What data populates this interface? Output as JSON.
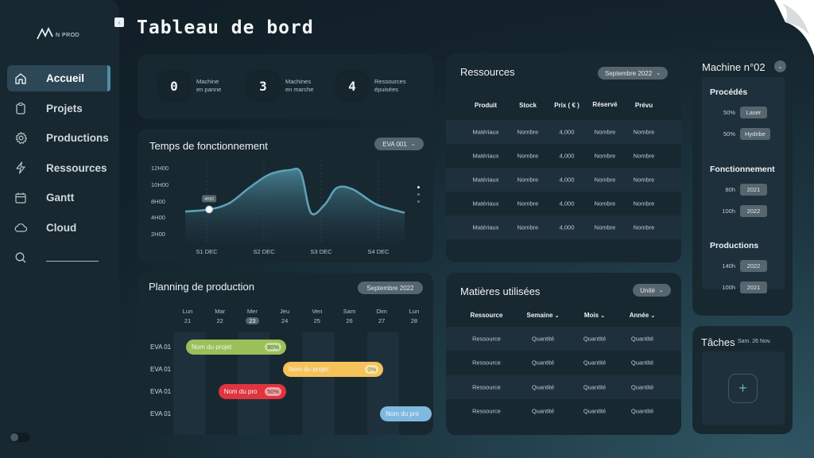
{
  "app": {
    "logo_text": "N PROD",
    "collapse_icon": "chevron-left-icon",
    "page_title": "Tableau de bord"
  },
  "sidebar": {
    "items": [
      {
        "label": "Accueil",
        "icon": "home-icon",
        "active": true
      },
      {
        "label": "Projets",
        "icon": "clipboard-icon",
        "active": false
      },
      {
        "label": "Productions",
        "icon": "gear-icon",
        "active": false
      },
      {
        "label": "Ressources",
        "icon": "lightning-icon",
        "active": false
      },
      {
        "label": "Gantt",
        "icon": "calendar-icon",
        "active": false
      },
      {
        "label": "Cloud",
        "icon": "cloud-icon",
        "active": false
      }
    ],
    "search_icon": "search-icon",
    "search_value": "",
    "toggle_on": false
  },
  "stats": [
    {
      "value": "0",
      "label_line1": "Machine",
      "label_line2": "en panne"
    },
    {
      "value": "3",
      "label_line1": "Machines",
      "label_line2": "en marche"
    },
    {
      "value": "4",
      "label_line1": "Ressources",
      "label_line2": "épuisées"
    }
  ],
  "uptime": {
    "title": "Temps de fonctionnement",
    "selector": "EVA 001",
    "tooltip": "4H50"
  },
  "chart_data": {
    "type": "area",
    "title": "Temps de fonctionnement",
    "xlabel": "",
    "ylabel": "",
    "x_ticks": [
      "S1 DEC",
      "S2 DEC",
      "S3 DEC",
      "S4 DEC"
    ],
    "y_ticks": [
      "12H00",
      "10H00",
      "8H00",
      "4H00",
      "2H00"
    ],
    "ylim": [
      0,
      12
    ],
    "grid": "vertical-dashed",
    "legend": "none",
    "series": [
      {
        "name": "EVA 001",
        "x": [
          0.4,
          1.0,
          1.5,
          2.0,
          2.5,
          3.0,
          3.3,
          3.55,
          3.9,
          4.2,
          4.6,
          5.2,
          5.9
        ],
        "values": [
          4.5,
          4.83,
          5.8,
          8.2,
          10.3,
          11.0,
          10.6,
          4.3,
          5.6,
          8.2,
          8.0,
          5.6,
          4.3
        ]
      }
    ],
    "highlight": {
      "x": 1.0,
      "value": 4.83,
      "label": "4H50"
    },
    "pager_dots": 3,
    "pager_active": 0
  },
  "planning": {
    "title": "Planning de production",
    "month": "Septembre 2022",
    "days": [
      {
        "name": "Lun",
        "num": "21",
        "today": false
      },
      {
        "name": "Mar",
        "num": "22",
        "today": false
      },
      {
        "name": "Mer",
        "num": "23",
        "today": true
      },
      {
        "name": "Jeu",
        "num": "24",
        "today": false
      },
      {
        "name": "Ven",
        "num": "25",
        "today": false
      },
      {
        "name": "Sam",
        "num": "26",
        "today": false
      },
      {
        "name": "Dim",
        "num": "27",
        "today": false
      },
      {
        "name": "Lun",
        "num": "28",
        "today": false
      }
    ],
    "rows": [
      {
        "label": "EVA 01",
        "project": "Nom du projet",
        "pct": "80%",
        "color": "#9bc05a",
        "start_day": 0,
        "end_day": 3
      },
      {
        "label": "EVA 01",
        "project": "Nom du projet",
        "pct": "0%",
        "color": "#f6c35a",
        "start_day": 3,
        "end_day": 6
      },
      {
        "label": "EVA 01",
        "project": "Nom du pro",
        "pct": "50%",
        "color": "#e0343f",
        "start_day": 1,
        "end_day": 3
      },
      {
        "label": "EVA 01",
        "project": "Nom du pro",
        "pct": "",
        "color": "#7fb9e0",
        "start_day": 6,
        "end_day": 7.5
      }
    ]
  },
  "resources": {
    "title": "Ressources",
    "month": "Septembre 2022",
    "columns": [
      "Produit",
      "Stock",
      "Prix ( € )",
      "Réservé",
      "Prévu"
    ],
    "rows": [
      [
        "Matériaux",
        "Nombre",
        "4,000",
        "Nombre",
        "Nombre"
      ],
      [
        "Matériaux",
        "Nombre",
        "4,000",
        "Nombre",
        "Nombre"
      ],
      [
        "Matériaux",
        "Nombre",
        "4,000",
        "Nombre",
        "Nombre"
      ],
      [
        "Matériaux",
        "Nombre",
        "4,000",
        "Nombre",
        "Nombre"
      ],
      [
        "Matériaux",
        "Nombre",
        "4,000",
        "Nombre",
        "Nombre"
      ]
    ]
  },
  "materials": {
    "title": "Matières utilisées",
    "unit_selector": "Unité",
    "columns": [
      "Ressource",
      "Semaine",
      "Mois",
      "Année"
    ],
    "rows": [
      [
        "Ressource",
        "Quantité",
        "Quantité",
        "Quantité"
      ],
      [
        "Ressource",
        "Quantité",
        "Quantité",
        "Quantité"
      ],
      [
        "Ressource",
        "Quantité",
        "Quantité",
        "Quantité"
      ],
      [
        "Ressource",
        "Quantité",
        "Quantité",
        "Quantité"
      ]
    ]
  },
  "machine": {
    "title": "Machine n°02",
    "sections": [
      {
        "title": "Procédés",
        "items": [
          {
            "key": "50%",
            "tag": "Laser"
          },
          {
            "key": "50%",
            "tag": "Hydribe"
          }
        ]
      },
      {
        "title": "Fonctionnement",
        "items": [
          {
            "key": "80h",
            "tag": "2021"
          },
          {
            "key": "100h",
            "tag": "2022"
          }
        ]
      },
      {
        "title": "Productions",
        "items": [
          {
            "key": "140h",
            "tag": "2022"
          },
          {
            "key": "100h",
            "tag": "2021"
          }
        ]
      }
    ]
  },
  "tasks": {
    "title": "Tâches",
    "date": "Sam. 26 Nov.",
    "add_icon": "plus-icon"
  }
}
